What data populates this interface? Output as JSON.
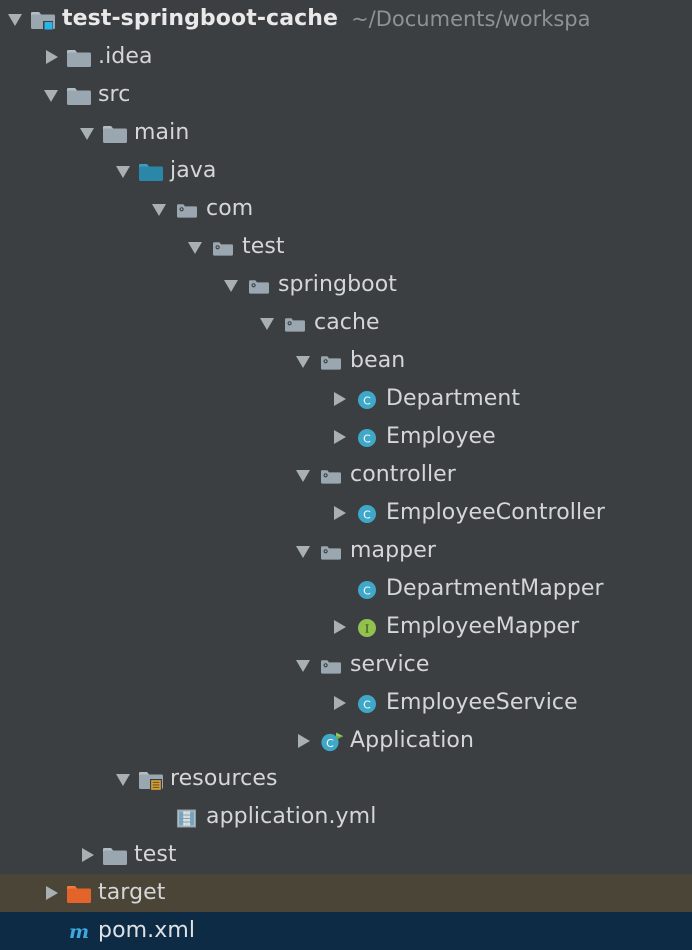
{
  "window": {
    "theme": "darcula",
    "background": "#3c3f41",
    "text_color": "#d4d6d7",
    "excluded_row_color": "#4b4537",
    "selected_row_color": "#0d2b45"
  },
  "project_tree": {
    "name": "project-tool-window",
    "rows": [
      {
        "label": "test-springboot-cache",
        "secondary": "~/Documents/workspa",
        "icon": "module-folder-icon",
        "twisty": "expanded",
        "depth": 0,
        "style": "root"
      },
      {
        "label": ".idea",
        "secondary": "",
        "icon": "folder-icon",
        "twisty": "collapsed",
        "depth": 1,
        "style": "normal"
      },
      {
        "label": "src",
        "secondary": "",
        "icon": "folder-icon",
        "twisty": "expanded",
        "depth": 1,
        "style": "normal"
      },
      {
        "label": "main",
        "secondary": "",
        "icon": "folder-icon",
        "twisty": "expanded",
        "depth": 2,
        "style": "normal"
      },
      {
        "label": "java",
        "secondary": "",
        "icon": "source-root-folder-icon",
        "twisty": "expanded",
        "depth": 3,
        "style": "normal"
      },
      {
        "label": "com",
        "secondary": "",
        "icon": "package-icon",
        "twisty": "expanded",
        "depth": 4,
        "style": "normal"
      },
      {
        "label": "test",
        "secondary": "",
        "icon": "package-icon",
        "twisty": "expanded",
        "depth": 5,
        "style": "normal"
      },
      {
        "label": "springboot",
        "secondary": "",
        "icon": "package-icon",
        "twisty": "expanded",
        "depth": 6,
        "style": "normal"
      },
      {
        "label": "cache",
        "secondary": "",
        "icon": "package-icon",
        "twisty": "expanded",
        "depth": 7,
        "style": "normal"
      },
      {
        "label": "bean",
        "secondary": "",
        "icon": "package-icon",
        "twisty": "expanded",
        "depth": 8,
        "style": "normal"
      },
      {
        "label": "Department",
        "secondary": "",
        "icon": "java-class-icon",
        "twisty": "collapsed",
        "depth": 9,
        "style": "normal"
      },
      {
        "label": "Employee",
        "secondary": "",
        "icon": "java-class-icon",
        "twisty": "collapsed",
        "depth": 9,
        "style": "normal"
      },
      {
        "label": "controller",
        "secondary": "",
        "icon": "package-icon",
        "twisty": "expanded",
        "depth": 8,
        "style": "normal"
      },
      {
        "label": "EmployeeController",
        "secondary": "",
        "icon": "java-class-icon",
        "twisty": "collapsed",
        "depth": 9,
        "style": "normal"
      },
      {
        "label": "mapper",
        "secondary": "",
        "icon": "package-icon",
        "twisty": "expanded",
        "depth": 8,
        "style": "normal"
      },
      {
        "label": "DepartmentMapper",
        "secondary": "",
        "icon": "java-class-icon",
        "twisty": "none",
        "depth": 9,
        "style": "normal"
      },
      {
        "label": "EmployeeMapper",
        "secondary": "",
        "icon": "java-interface-icon",
        "twisty": "collapsed",
        "depth": 9,
        "style": "normal"
      },
      {
        "label": "service",
        "secondary": "",
        "icon": "package-icon",
        "twisty": "expanded",
        "depth": 8,
        "style": "normal"
      },
      {
        "label": "EmployeeService",
        "secondary": "",
        "icon": "java-class-icon",
        "twisty": "collapsed",
        "depth": 9,
        "style": "normal"
      },
      {
        "label": "Application",
        "secondary": "",
        "icon": "runnable-class-icon",
        "twisty": "collapsed",
        "depth": 8,
        "style": "normal"
      },
      {
        "label": "resources",
        "secondary": "",
        "icon": "resource-root-folder-icon",
        "twisty": "expanded",
        "depth": 3,
        "style": "normal"
      },
      {
        "label": "application.yml",
        "secondary": "",
        "icon": "yaml-file-icon",
        "twisty": "none",
        "depth": 4,
        "style": "normal"
      },
      {
        "label": "test",
        "secondary": "",
        "icon": "folder-icon",
        "twisty": "collapsed",
        "depth": 2,
        "style": "normal"
      },
      {
        "label": "target",
        "secondary": "",
        "icon": "excluded-folder-icon",
        "twisty": "collapsed",
        "depth": 1,
        "style": "excluded"
      },
      {
        "label": "pom.xml",
        "secondary": "",
        "icon": "maven-file-icon",
        "twisty": "none",
        "depth": 1,
        "style": "selected"
      }
    ]
  }
}
